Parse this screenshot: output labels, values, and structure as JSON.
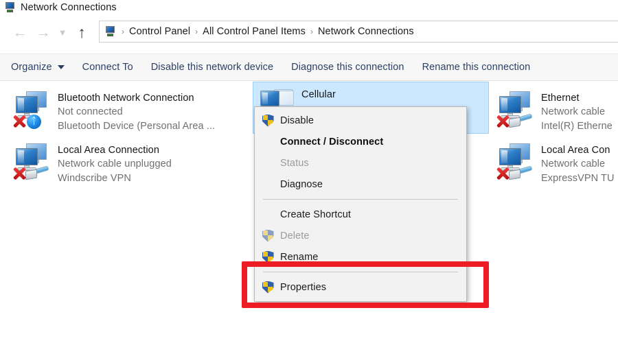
{
  "window": {
    "title": "Network Connections",
    "title_icon": "network-connections-icon"
  },
  "navigation": {
    "back_icon": "arrow-left-icon",
    "forward_icon": "arrow-right-icon",
    "recent_icon": "chevron-down-icon",
    "up_icon": "arrow-up-icon",
    "address_icon": "control-panel-icon",
    "breadcrumbs": [
      {
        "label": "Control Panel"
      },
      {
        "label": "All Control Panel Items"
      },
      {
        "label": "Network Connections"
      }
    ],
    "separator": "›"
  },
  "toolbar": {
    "items": [
      {
        "label": "Organize",
        "has_caret": true
      },
      {
        "label": "Connect To",
        "has_caret": false
      },
      {
        "label": "Disable this network device",
        "has_caret": false
      },
      {
        "label": "Diagnose this connection",
        "has_caret": false
      },
      {
        "label": "Rename this connection",
        "has_caret": false
      }
    ]
  },
  "connections": {
    "column1": [
      {
        "name": "Bluetooth Network Connection",
        "status": "Not connected",
        "device": "Bluetooth Device (Personal Area ...",
        "icon": "network-adapter-icon",
        "badge": "bluetooth-icon",
        "disabled_x": true,
        "selected": false
      },
      {
        "name": "Local Area Connection",
        "status": "Network cable unplugged",
        "device": "Windscribe VPN",
        "icon": "network-adapter-icon",
        "badge": "ethernet-cable-icon",
        "disabled_x": true,
        "selected": false
      }
    ],
    "column2": [
      {
        "name": "Cellular",
        "status": "",
        "device": "...",
        "icon": "cellular-adapter-icon",
        "badge": "none",
        "disabled_x": false,
        "selected": true
      }
    ],
    "column3": [
      {
        "name": "Ethernet",
        "status": "Network cable",
        "device": "Intel(R) Etherne",
        "icon": "network-adapter-icon",
        "badge": "ethernet-cable-icon",
        "disabled_x": true,
        "selected": false
      },
      {
        "name": "Local Area Con",
        "status": "Network cable",
        "device": "ExpressVPN TU",
        "icon": "network-adapter-icon",
        "badge": "ethernet-cable-icon",
        "disabled_x": true,
        "selected": false
      }
    ]
  },
  "context_menu": {
    "items": [
      {
        "label": "Disable",
        "type": "item",
        "shield": true,
        "bold": false,
        "disabled": false
      },
      {
        "label": "Connect / Disconnect",
        "type": "item",
        "shield": false,
        "bold": true,
        "disabled": false
      },
      {
        "label": "Status",
        "type": "item",
        "shield": false,
        "bold": false,
        "disabled": true
      },
      {
        "label": "Diagnose",
        "type": "item",
        "shield": false,
        "bold": false,
        "disabled": false
      },
      {
        "label": "",
        "type": "separator",
        "shield": false,
        "bold": false,
        "disabled": false
      },
      {
        "label": "Create Shortcut",
        "type": "item",
        "shield": false,
        "bold": false,
        "disabled": false
      },
      {
        "label": "Delete",
        "type": "item",
        "shield": true,
        "bold": false,
        "disabled": true
      },
      {
        "label": "Rename",
        "type": "item",
        "shield": true,
        "bold": false,
        "disabled": false
      },
      {
        "label": "",
        "type": "separator",
        "shield": false,
        "bold": false,
        "disabled": false
      },
      {
        "label": "Properties",
        "type": "item",
        "shield": true,
        "bold": false,
        "disabled": false
      }
    ]
  },
  "annotation": {
    "shape": "rectangle",
    "color": "#ee1c25",
    "targets": "Properties"
  }
}
